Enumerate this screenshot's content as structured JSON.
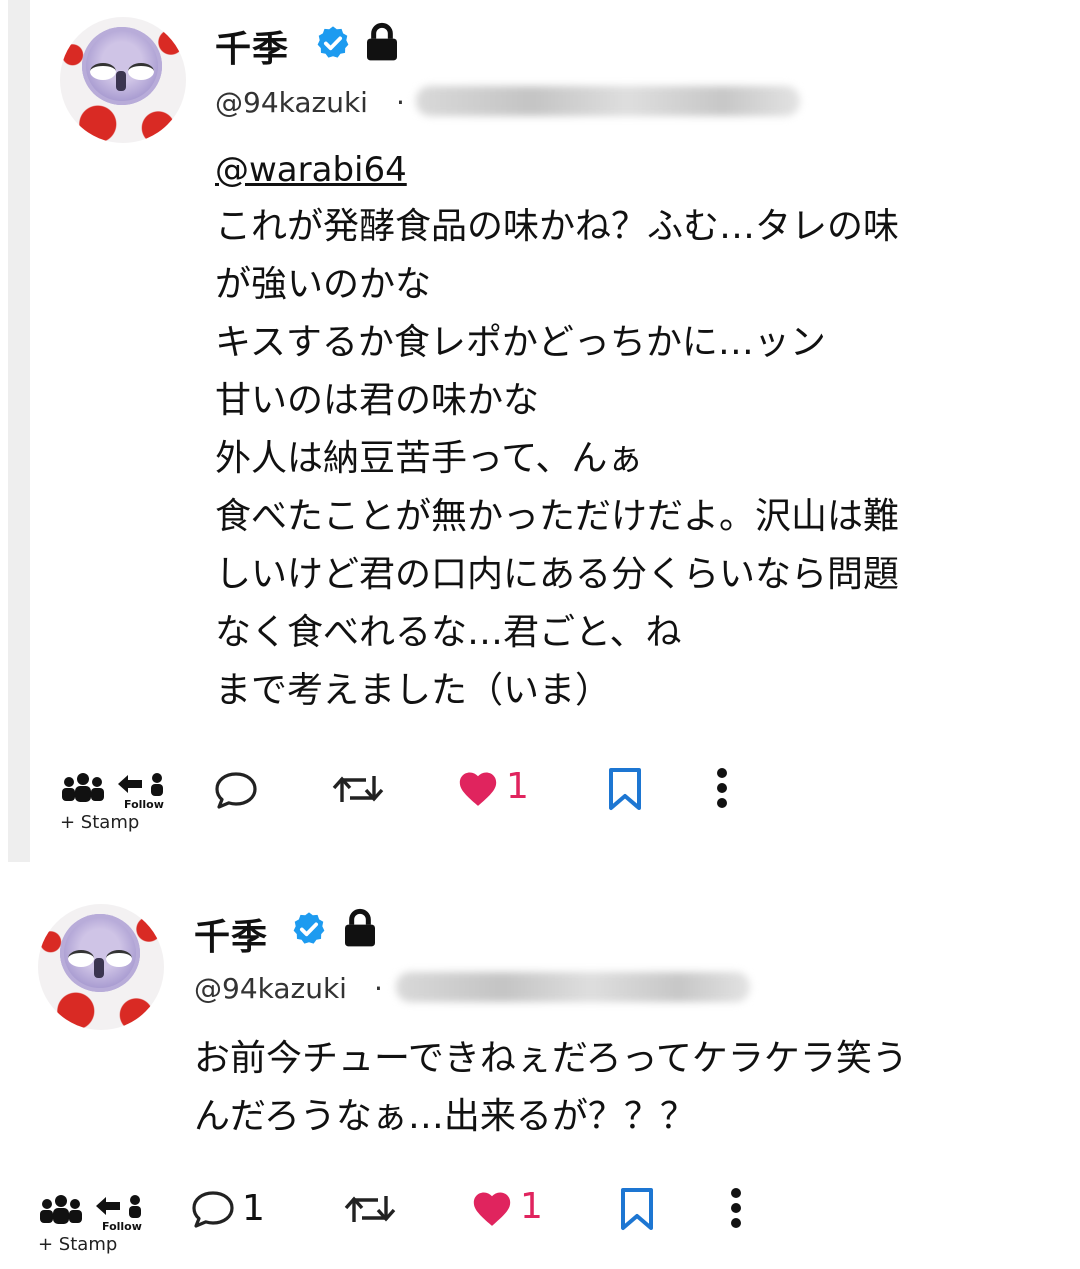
{
  "posts": [
    {
      "author": {
        "display_name": "千季",
        "handle": "@94kazuki",
        "separator": "·"
      },
      "mention": "@warabi64",
      "body": "これが発酵食品の味かね？ふむ…タレの味\nが強いのかな\nキスするか食レポかどっちかに…ッン\n甘いのは君の味かな\n外人は納豆苦手って、んぁ\n食べたことが無かっただけだよ。沢山は難\nしいけど君の口内にある分くらいなら問題\nなく食べれるな…君ごと、ね\nまで考えました（いま）",
      "actions": {
        "stamp_label": "+ Stamp",
        "follow_label": "Follow",
        "reply_count": "",
        "like_count": "1"
      }
    },
    {
      "author": {
        "display_name": "千季",
        "handle": "@94kazuki",
        "separator": "·"
      },
      "mention": "",
      "body": "お前今チューできねぇだろってケラケラ笑う\nんだろうなぁ…出来るが？？？",
      "actions": {
        "stamp_label": "+ Stamp",
        "follow_label": "Follow",
        "reply_count": "1",
        "like_count": "1"
      }
    }
  ],
  "colors": {
    "verified_blue": "#1d9bf0",
    "like_red": "#e0245e",
    "bookmark_blue": "#1d76d2"
  },
  "icons": [
    "verified-badge-icon",
    "lock-icon",
    "people-icon",
    "follow-arrow-icon",
    "reply-icon",
    "repost-icon",
    "heart-icon",
    "bookmark-icon",
    "more-icon"
  ]
}
